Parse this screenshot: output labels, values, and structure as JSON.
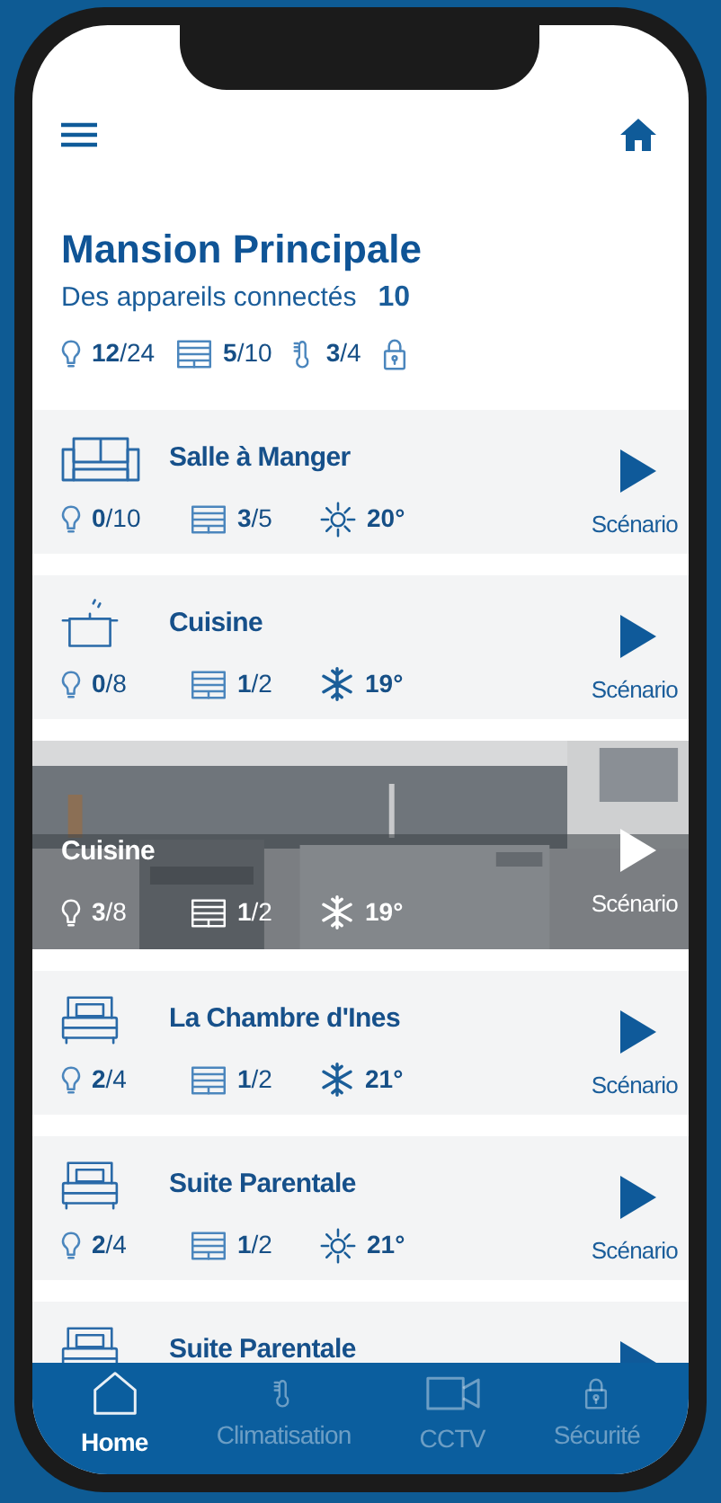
{
  "header": {
    "title": "Mansion Principale",
    "subtitle": "Des appareils connectés",
    "device_count": "10",
    "stats": [
      {
        "kind": "light",
        "text": "**12**/24"
      },
      {
        "kind": "blinds",
        "text": "**5**/10"
      },
      {
        "kind": "thermo",
        "text": "**3**/4"
      },
      {
        "kind": "lock"
      }
    ]
  },
  "rooms": [
    {
      "name": "Salle à Manger",
      "kind": "sofa",
      "stats": [
        {
          "kind": "light",
          "text": "**0**/10"
        },
        {
          "kind": "blinds",
          "text": "**3**/5"
        },
        {
          "kind": "sun",
          "text": "20°"
        }
      ],
      "action": "Scénario"
    },
    {
      "name": "Cuisine",
      "kind": "pot",
      "stats": [
        {
          "kind": "light",
          "text": "**0**/8"
        },
        {
          "kind": "blinds",
          "text": "**1**/2"
        },
        {
          "kind": "snow",
          "text": "19°"
        }
      ],
      "action": "Scénario"
    },
    {
      "name": "Cuisine",
      "kind": "picture",
      "stats": [
        {
          "kind": "light",
          "text": "**3**/8"
        },
        {
          "kind": "blinds",
          "text": "**1**/2"
        },
        {
          "kind": "snow",
          "text": "19°"
        }
      ],
      "action": "Scénario"
    },
    {
      "name": "La Chambre d'Ines",
      "kind": "bed",
      "stats": [
        {
          "kind": "light",
          "text": "**2**/4"
        },
        {
          "kind": "blinds",
          "text": "**1**/2"
        },
        {
          "kind": "snow",
          "text": "21°"
        }
      ],
      "action": "Scénario"
    },
    {
      "name": "Suite Parentale",
      "kind": "bed",
      "stats": [
        {
          "kind": "light",
          "text": "**2**/4"
        },
        {
          "kind": "blinds",
          "text": "**1**/2"
        },
        {
          "kind": "sun",
          "text": "21°"
        }
      ],
      "action": "Scénario"
    },
    {
      "name": "Suite Parentale",
      "kind": "bed"
    }
  ],
  "nav": [
    {
      "label": "Home",
      "kind": "house",
      "selected": true
    },
    {
      "label": "Climatisation",
      "kind": "thermo",
      "selected": false
    },
    {
      "label": "CCTV",
      "kind": "camera",
      "selected": false
    },
    {
      "label": "Sécurité",
      "kind": "lock",
      "selected": false
    }
  ]
}
